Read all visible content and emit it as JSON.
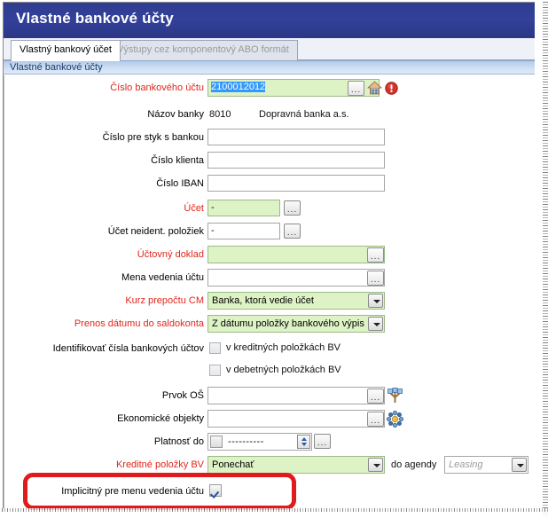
{
  "window": {
    "title": "Vlastné bankové účty"
  },
  "tabs": [
    {
      "label": "Vlastný bankový účet",
      "active": true,
      "disabled": false
    },
    {
      "label": "Výstupy cez komponentový ABO formát",
      "active": false,
      "disabled": true
    }
  ],
  "group_band": {
    "label": "Vlastné bankové účty"
  },
  "colors": {
    "titlebar": "#32409b",
    "required_label": "#e1251b",
    "required_field_bg": "#ddf3c6",
    "group_band": "#cfe0f4",
    "selection": "#3399ff",
    "annotation": "#e01b1b"
  },
  "fields": {
    "account_number": {
      "label": "Číslo bankového účtu",
      "required": true,
      "value": "2100012012",
      "selected": true,
      "browse_label": "...",
      "icons": [
        "home-icon",
        "error-icon"
      ]
    },
    "bank_name": {
      "label": "Názov banky",
      "required": false,
      "code": "8010",
      "name": "Dopravná banka a.s."
    },
    "bank_contact_number": {
      "label": "Číslo pre styk s bankou",
      "required": false,
      "value": "",
      "placeholder": ""
    },
    "client_number": {
      "label": "Číslo klienta",
      "required": false,
      "value": "",
      "placeholder": ""
    },
    "iban_number": {
      "label": "Číslo IBAN",
      "required": false,
      "value": "",
      "placeholder": ""
    },
    "account": {
      "label": "Účet",
      "required": true,
      "value": "-",
      "browse_label": "..."
    },
    "unidentified_items_account": {
      "label": "Účet neident. položiek",
      "required": false,
      "value": "-",
      "browse_label": "..."
    },
    "accounting_document": {
      "label": "Účtovný doklad",
      "required": true,
      "value": "",
      "browse_label": "..."
    },
    "account_currency": {
      "label": "Mena vedenia účtu",
      "required": false,
      "value": "",
      "browse_label": "..."
    },
    "fx_rate": {
      "label": "Kurz prepočtu CM",
      "required": true,
      "value": "Banka, ktorá vedie účet"
    },
    "date_transfer": {
      "label": "Prenos dátumu do saldokonta",
      "required": true,
      "value": "Z dátumu položky bankového výpis"
    },
    "identify_accounts": {
      "label": "Identifikovať čísla bankových účtov",
      "required": false,
      "options": [
        {
          "label": "v kreditných položkách BV",
          "checked": false
        },
        {
          "label": "v debetných položkách BV",
          "checked": false
        }
      ]
    },
    "org_element": {
      "label": "Prvok OŠ",
      "required": false,
      "value": "",
      "browse_label": "...",
      "icon": "org-tree-icon"
    },
    "economic_objects": {
      "label": "Ekonomické objekty",
      "required": false,
      "value": "",
      "browse_label": "...",
      "icon": "object-cluster-icon"
    },
    "valid_until": {
      "label": "Platnosť do",
      "required": false,
      "enabled": false,
      "value": "----------",
      "browse_label": "..."
    },
    "credit_items": {
      "label": "Kreditné položky BV",
      "required": true,
      "value": "Ponechať",
      "secondary_label": "do agendy",
      "secondary_value": "Leasing",
      "secondary_disabled": true
    },
    "implicit_default": {
      "label": "Implicitný pre menu vedenia účtu",
      "required": false,
      "checked": true,
      "highlighted": true
    }
  }
}
